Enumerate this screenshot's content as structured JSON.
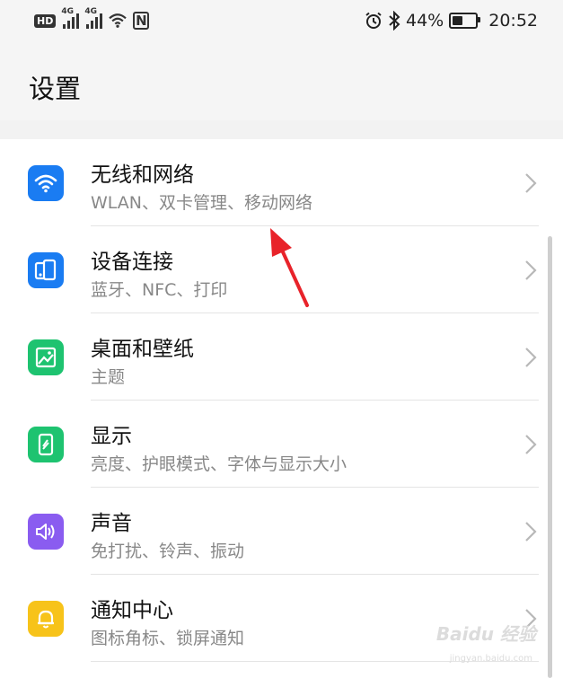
{
  "status_bar": {
    "hd_label": "HD",
    "network_1": "4G",
    "network_2": "4G",
    "nfc_label": "N",
    "battery_text": "44%",
    "battery_level": 0.44,
    "time": "20:52"
  },
  "header": {
    "title": "设置"
  },
  "settings": [
    {
      "title": "无线和网络",
      "subtitle": "WLAN、双卡管理、移动网络",
      "icon": "wifi-icon",
      "color": "#1a7cf2"
    },
    {
      "title": "设备连接",
      "subtitle": "蓝牙、NFC、打印",
      "icon": "device-connection-icon",
      "color": "#1a7cf2"
    },
    {
      "title": "桌面和壁纸",
      "subtitle": "主题",
      "icon": "wallpaper-icon",
      "color": "#1ec370"
    },
    {
      "title": "显示",
      "subtitle": "亮度、护眼模式、字体与显示大小",
      "icon": "display-icon",
      "color": "#1ec370"
    },
    {
      "title": "声音",
      "subtitle": "免打扰、铃声、振动",
      "icon": "speaker-icon",
      "color": "#8a5cf0"
    },
    {
      "title": "通知中心",
      "subtitle": "图标角标、锁屏通知",
      "icon": "bell-icon",
      "color": "#f7c31a"
    }
  ],
  "watermark": {
    "text": "Baidu 经验",
    "sub": "jingyan.baidu.com"
  }
}
